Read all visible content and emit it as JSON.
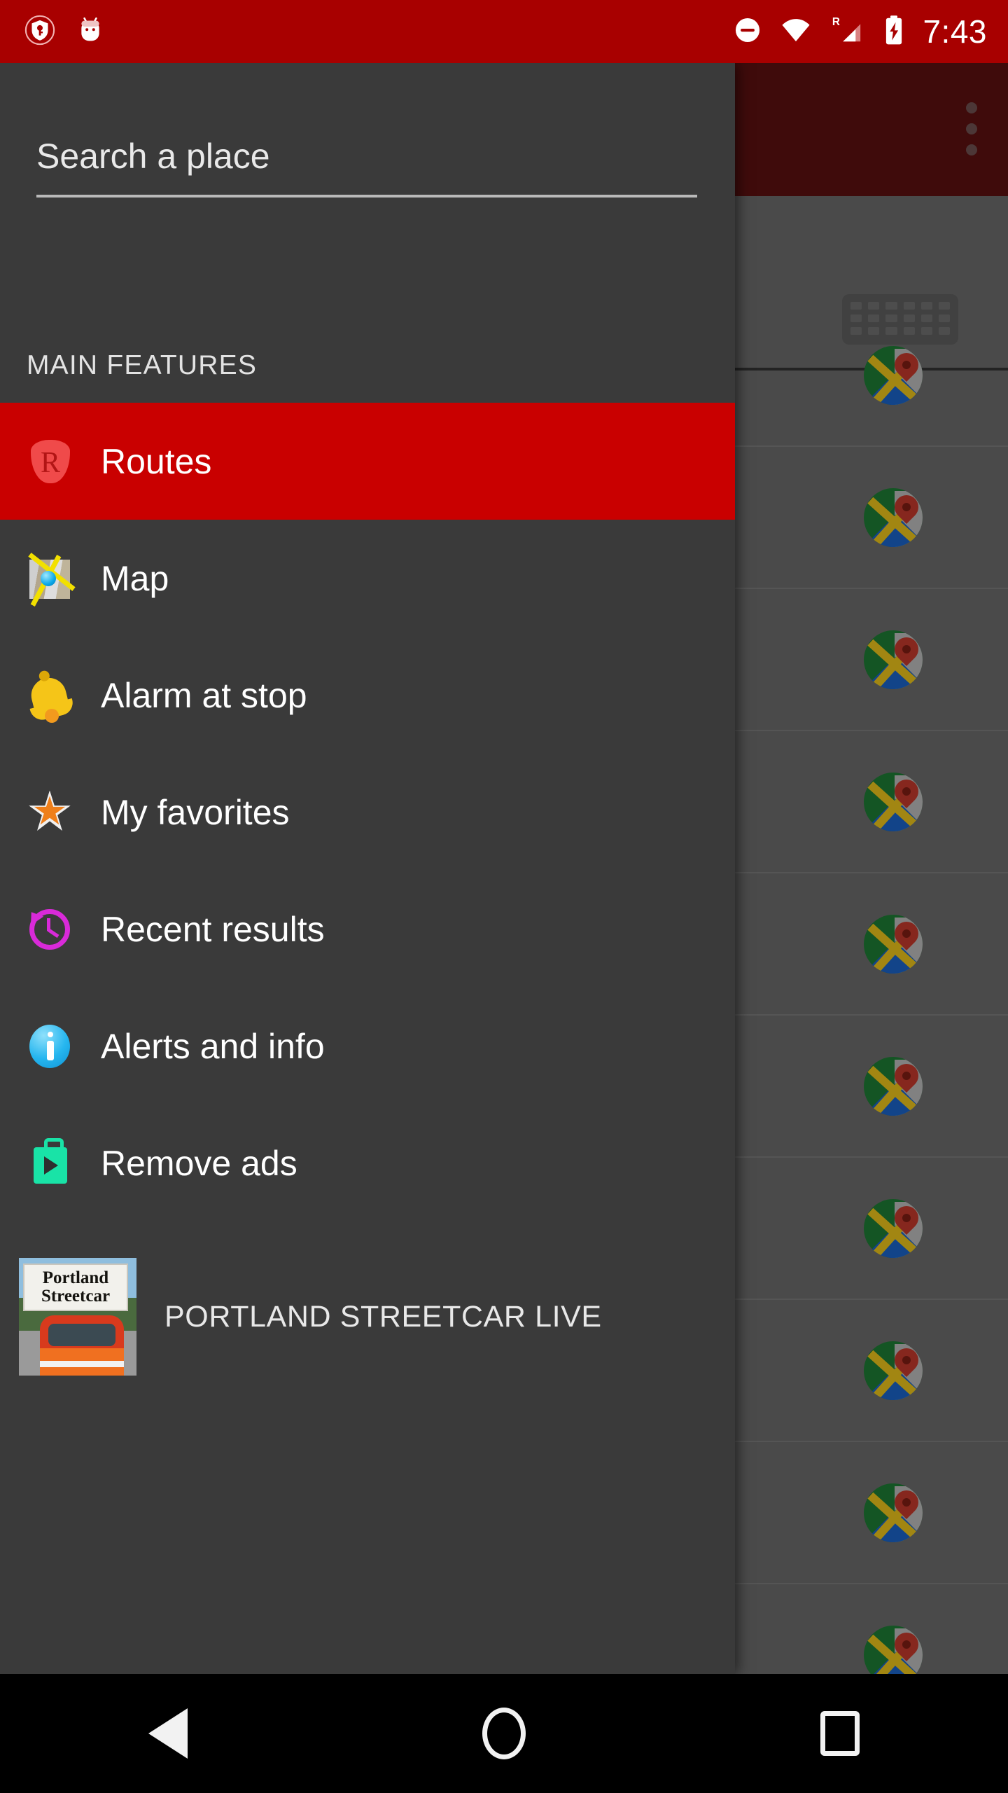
{
  "status_bar": {
    "icons": [
      "vpn-key-shield-icon",
      "android-mascot-icon",
      "do-not-disturb-icon",
      "wifi-icon",
      "cellular-roaming-icon",
      "battery-charging-icon"
    ],
    "roaming_label": "R",
    "time": "7:43",
    "background_color": "#a80000"
  },
  "drawer": {
    "search": {
      "placeholder": "Search a place",
      "value": ""
    },
    "section_header": "MAIN FEATURES",
    "items": [
      {
        "label": "Routes",
        "icon": "route-shield-icon",
        "selected": true
      },
      {
        "label": "Map",
        "icon": "folded-map-icon",
        "selected": false
      },
      {
        "label": "Alarm at stop",
        "icon": "bell-icon",
        "selected": false
      },
      {
        "label": "My favorites",
        "icon": "star-icon",
        "selected": false
      },
      {
        "label": "Recent results",
        "icon": "history-clock-icon",
        "selected": false
      },
      {
        "label": "Alerts and info",
        "icon": "info-circle-icon",
        "selected": false
      },
      {
        "label": "Remove ads",
        "icon": "play-store-bag-icon",
        "selected": false
      }
    ],
    "promo": {
      "label": "PORTLAND STREETCAR LIVE",
      "thumb_sign_line1": "Portland",
      "thumb_sign_line2": "Streetcar"
    },
    "selected_color": "#c90000",
    "background_color": "#3a3a3a"
  },
  "content_behind": {
    "appbar_color": "#5b1010",
    "overflow_menu": "overflow-menu-icon",
    "keyboard_button": "keyboard-icon",
    "rows": [
      {
        "icon": "google-maps-icon"
      },
      {
        "icon": "google-maps-icon"
      },
      {
        "icon": "google-maps-icon"
      },
      {
        "icon": "google-maps-icon"
      },
      {
        "icon": "google-maps-icon"
      },
      {
        "icon": "google-maps-icon"
      },
      {
        "icon": "google-maps-icon"
      },
      {
        "icon": "google-maps-icon"
      },
      {
        "icon": "google-maps-icon"
      },
      {
        "icon": "google-maps-icon"
      }
    ]
  },
  "nav_bar": {
    "back": "back-icon",
    "home": "home-icon",
    "recents": "recents-icon"
  }
}
